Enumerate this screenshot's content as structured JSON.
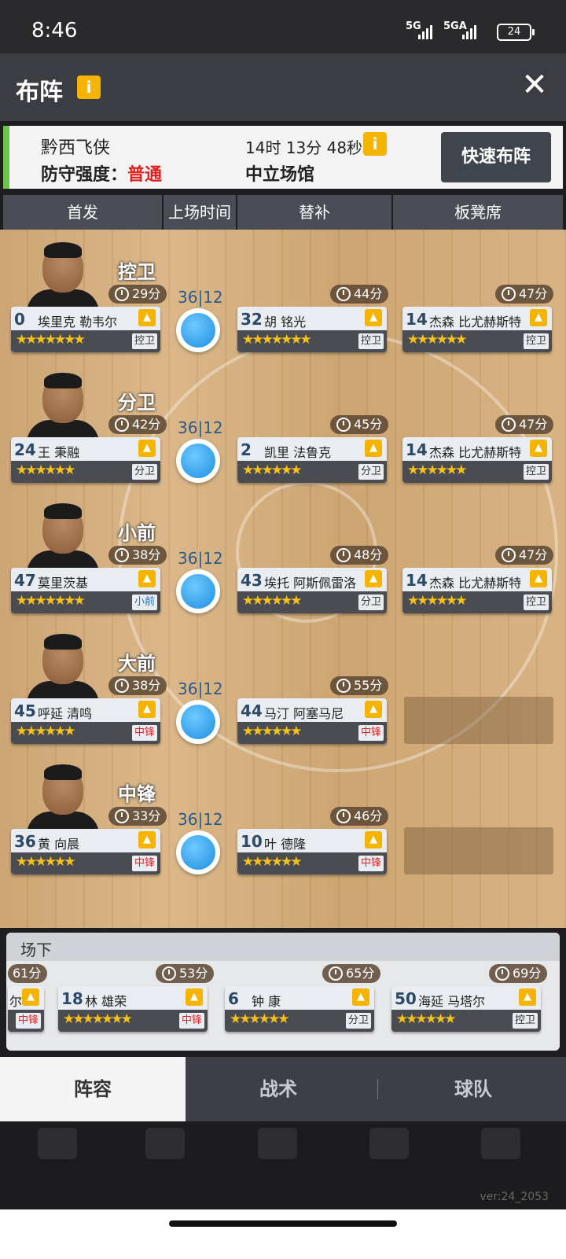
{
  "status": {
    "time": "8:46",
    "net1": "5G",
    "net2": "5GA",
    "battery": "24"
  },
  "header": {
    "title": "布阵",
    "info_icon": "info-icon",
    "close_icon": "close-icon"
  },
  "opponent": {
    "team": "黔西飞侠",
    "defense_label": "防守强度：",
    "defense_level": "普通",
    "timer": "14时 13分 48秒",
    "venue": "中立场馆",
    "quick_button": "快速布阵"
  },
  "columns": [
    "首发",
    "上场时间",
    "替补",
    "板凳席"
  ],
  "rows": [
    {
      "position": "控卫",
      "starter": {
        "minutes": "29分",
        "number": "0",
        "name": "埃里克 勒韦尔",
        "stars": "★★★★★★★",
        "pos": "控卫",
        "pos_color": "normal"
      },
      "playtime": "36|12",
      "sub": {
        "minutes": "44分",
        "number": "32",
        "name": "胡 铭光",
        "stars": "★★★★★★★",
        "pos": "控卫",
        "pos_color": "normal"
      },
      "bench": {
        "minutes": "47分",
        "number": "14",
        "name": "杰森 比尤赫斯特",
        "stars": "★★★★★★",
        "pos": "控卫",
        "pos_color": "normal"
      }
    },
    {
      "position": "分卫",
      "starter": {
        "minutes": "42分",
        "number": "24",
        "name": "王 秉融",
        "stars": "★★★★★★",
        "pos": "分卫",
        "pos_color": "normal"
      },
      "playtime": "36|12",
      "sub": {
        "minutes": "45分",
        "number": "2",
        "name": "凯里 法鲁克",
        "stars": "★★★★★★",
        "pos": "分卫",
        "pos_color": "normal"
      },
      "bench": {
        "minutes": "47分",
        "number": "14",
        "name": "杰森 比尤赫斯特",
        "stars": "★★★★★★",
        "pos": "控卫",
        "pos_color": "normal"
      }
    },
    {
      "position": "小前",
      "starter": {
        "minutes": "38分",
        "number": "47",
        "name": "莫里茨基",
        "stars": "★★★★★★★",
        "pos": "小前",
        "pos_color": "blue"
      },
      "playtime": "36|12",
      "sub": {
        "minutes": "48分",
        "number": "43",
        "name": "埃托 阿斯佩雷洛",
        "stars": "★★★★★★",
        "pos": "分卫",
        "pos_color": "normal"
      },
      "bench": {
        "minutes": "47分",
        "number": "14",
        "name": "杰森 比尤赫斯特",
        "stars": "★★★★★★",
        "pos": "控卫",
        "pos_color": "normal"
      }
    },
    {
      "position": "大前",
      "starter": {
        "minutes": "38分",
        "number": "45",
        "name": "呼延 清鸣",
        "stars": "★★★★★★",
        "pos": "中锋",
        "pos_color": "red"
      },
      "playtime": "36|12",
      "sub": {
        "minutes": "55分",
        "number": "44",
        "name": "马汀 阿塞马尼",
        "stars": "★★★★★★",
        "pos": "中锋",
        "pos_color": "red"
      },
      "bench": null
    },
    {
      "position": "中锋",
      "starter": {
        "minutes": "33分",
        "number": "36",
        "name": "黄 向晨",
        "stars": "★★★★★★",
        "pos": "中锋",
        "pos_color": "red"
      },
      "playtime": "36|12",
      "sub": {
        "minutes": "46分",
        "number": "10",
        "name": "叶 德隆",
        "stars": "★★★★★★",
        "pos": "中锋",
        "pos_color": "red"
      },
      "bench": null
    }
  ],
  "reserves": {
    "title": "场下",
    "partial": {
      "minutes": "61分",
      "number": "",
      "name": "尔",
      "pos": "中锋",
      "pos_color": "red"
    },
    "players": [
      {
        "minutes": "53分",
        "number": "18",
        "name": "林 雄荣",
        "stars": "★★★★★★★",
        "pos": "中锋",
        "pos_color": "red"
      },
      {
        "minutes": "65分",
        "number": "6",
        "name": "钟 康",
        "stars": "★★★★★★",
        "pos": "分卫",
        "pos_color": "normal"
      },
      {
        "minutes": "69分",
        "number": "50",
        "name": "海延 马塔尔",
        "stars": "★★★★★★",
        "pos": "控卫",
        "pos_color": "normal"
      }
    ]
  },
  "tabs": [
    "阵容",
    "战术",
    "球队"
  ],
  "active_tab": "阵容",
  "version": "ver:24_2053",
  "colors": {
    "accent_green": "#6cc24a",
    "gold": "#f4b400",
    "red": "#e02020"
  }
}
